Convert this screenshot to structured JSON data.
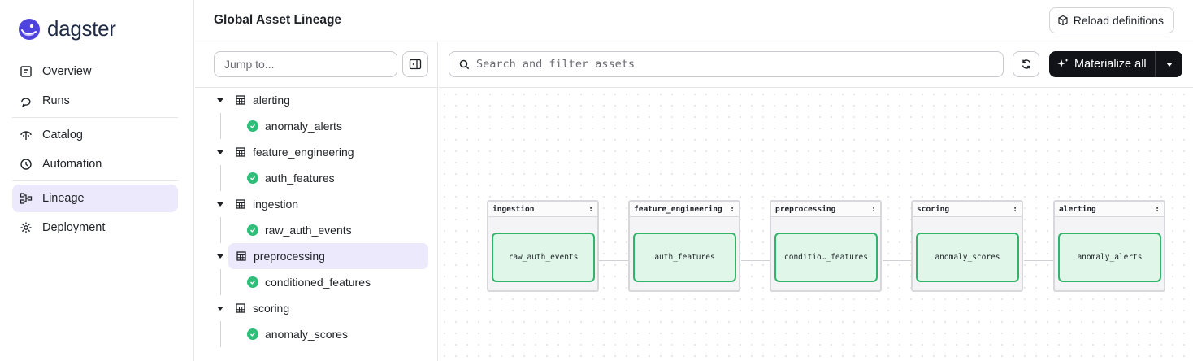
{
  "app": {
    "logo_text": "dagster"
  },
  "nav": {
    "items": [
      {
        "label": "Overview",
        "icon": "overview-icon"
      },
      {
        "label": "Runs",
        "icon": "runs-icon"
      },
      {
        "label": "Catalog",
        "icon": "catalog-icon"
      },
      {
        "label": "Automation",
        "icon": "automation-icon"
      },
      {
        "label": "Lineage",
        "icon": "lineage-icon",
        "active": true
      },
      {
        "label": "Deployment",
        "icon": "deployment-icon"
      }
    ]
  },
  "header": {
    "title": "Global Asset Lineage",
    "reload_label": "Reload definitions"
  },
  "tree": {
    "jump_placeholder": "Jump to...",
    "groups": [
      {
        "name": "alerting",
        "asset": "anomaly_alerts"
      },
      {
        "name": "feature_engineering",
        "asset": "auth_features"
      },
      {
        "name": "ingestion",
        "asset": "raw_auth_events"
      },
      {
        "name": "preprocessing",
        "asset": "conditioned_features",
        "active": true
      },
      {
        "name": "scoring",
        "asset": "anomaly_scores"
      }
    ]
  },
  "graph": {
    "search_placeholder": "Search and filter assets",
    "materialize_label": "Materialize all",
    "groups": [
      {
        "name": "ingestion",
        "menu": ":",
        "asset": "raw_auth_events"
      },
      {
        "name": "feature_engineering",
        "menu": ":",
        "asset": "auth_features"
      },
      {
        "name": "preprocessing",
        "menu": ":",
        "asset": "conditio…_features"
      },
      {
        "name": "scoring",
        "menu": ":",
        "asset": "anomaly_scores"
      },
      {
        "name": "alerting",
        "menu": ":",
        "asset": "anomaly_alerts"
      }
    ]
  },
  "colors": {
    "accent_active_bg": "#ebe9fb",
    "asset_green": "#31b36b",
    "asset_fill": "#dff6e9",
    "primary_button": "#111319"
  }
}
